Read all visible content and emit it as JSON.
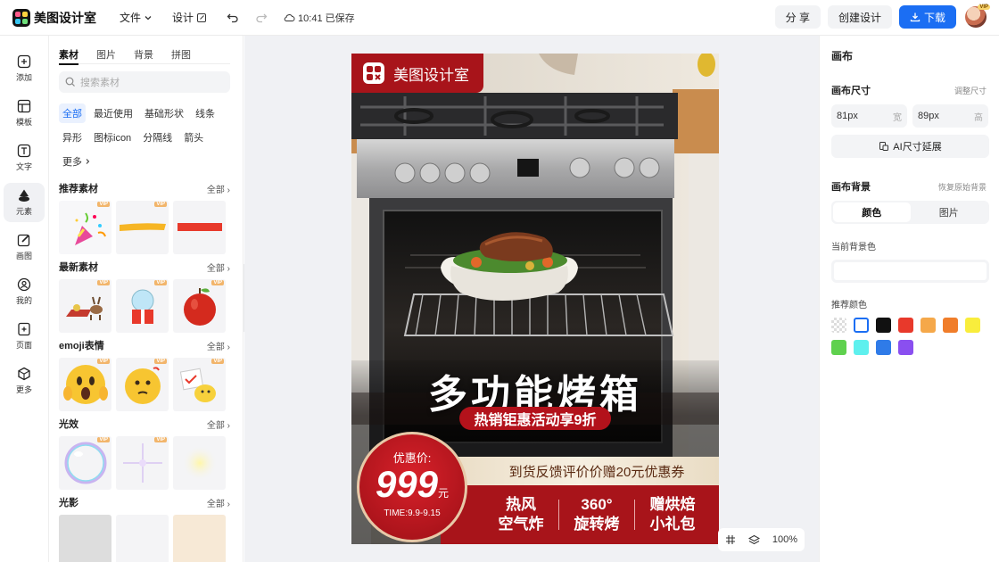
{
  "topbar": {
    "app_name": "美图设计室",
    "file_menu": "文件",
    "design_menu": "设计",
    "saved_status": "10:41 已保存",
    "share": "分 享",
    "create_design": "创建设计",
    "download": "下载",
    "avatar_badge": "VIP"
  },
  "left_nav": [
    {
      "label": "添加",
      "icon": "plus-square-icon"
    },
    {
      "label": "模板",
      "icon": "template-icon"
    },
    {
      "label": "文字",
      "icon": "text-icon"
    },
    {
      "label": "元素",
      "icon": "shapes-icon"
    },
    {
      "label": "画图",
      "icon": "draw-icon"
    },
    {
      "label": "我的",
      "icon": "user-icon"
    },
    {
      "label": "页面",
      "icon": "page-icon"
    },
    {
      "label": "更多",
      "icon": "more-cube-icon"
    }
  ],
  "material_panel": {
    "tabs": [
      "素材",
      "图片",
      "背景",
      "拼图"
    ],
    "search_placeholder": "搜索素材",
    "chips": [
      "全部",
      "最近使用",
      "基础形状",
      "线条",
      "异形",
      "图标icon",
      "分隔线",
      "箭头",
      "更多"
    ],
    "vip_badge": "VIP",
    "see_all": "全部",
    "sections": [
      {
        "title": "推荐素材"
      },
      {
        "title": "最新素材"
      },
      {
        "title": "emoji表情"
      },
      {
        "title": "光效"
      },
      {
        "title": "光影"
      }
    ]
  },
  "poster": {
    "brand": "美图设计室",
    "headline": "多功能烤箱",
    "promo_tag": "热销钜惠活动享9折",
    "price_label": "优惠价:",
    "price": "999",
    "price_unit": "元",
    "time_range": "TIME:9.9-9.15",
    "feedback_banner": "到货反馈评价价赠20元优惠券",
    "features": [
      {
        "line1": "热风",
        "line2": "空气炸"
      },
      {
        "line1": "360°",
        "line2": "旋转烤"
      },
      {
        "line1": "赠烘焙",
        "line2": "小礼包"
      }
    ]
  },
  "zoom": {
    "level": "100%"
  },
  "right_panel": {
    "title": "画布",
    "size_label": "画布尺寸",
    "size_adjust": "调整尺寸",
    "width_value": "81px",
    "width_unit": "宽",
    "height_value": "89px",
    "height_unit": "高",
    "ai_extend": "AI尺寸延展",
    "bg_label": "画布背景",
    "bg_restore": "恢复原始背景",
    "bg_tabs": [
      "颜色",
      "图片"
    ],
    "current_bg": "当前背景色",
    "recommend_colors_label": "推荐颜色",
    "colors": [
      "transparent",
      "#ffffff",
      "#111111",
      "#e8392b",
      "#f5a84a",
      "#f07d2a",
      "#f9ed3c",
      "#5fd14e",
      "#5ef0ee",
      "#2f7be8",
      "#8a4ff0"
    ]
  },
  "colors": {
    "accent": "#1b6ef3",
    "poster_red": "#a8141a"
  }
}
